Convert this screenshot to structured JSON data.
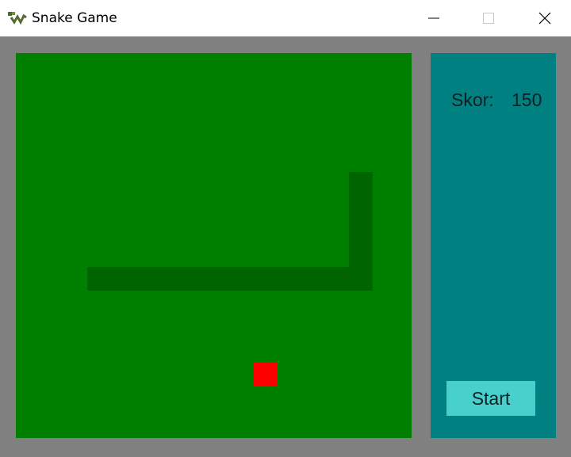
{
  "window": {
    "title": "Snake Game",
    "app_icon": "snake-icon",
    "controls": [
      "minimize-icon",
      "maximize-icon",
      "close-icon"
    ]
  },
  "game": {
    "board_color": "#008000",
    "snake_color": "#006400",
    "food_color": "#ff0000"
  },
  "panel": {
    "background": "#008080",
    "score_label": "Skor:",
    "score_value": "150",
    "start_label": "Start",
    "start_color": "#48d1cc"
  }
}
